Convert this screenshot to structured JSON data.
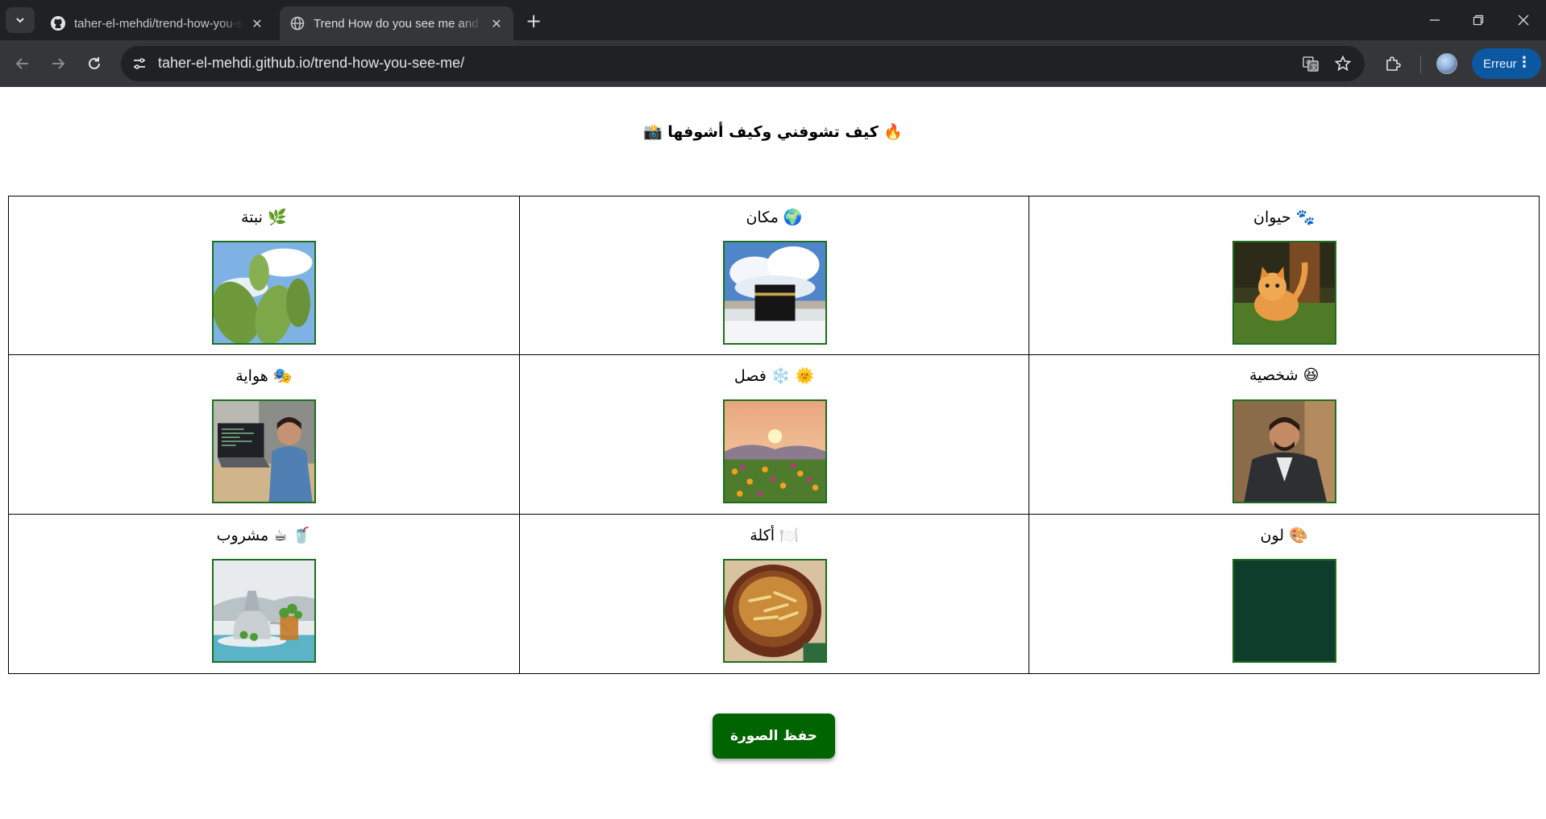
{
  "browser": {
    "tabs": [
      {
        "title": "taher-el-mehdi/trend-how-you-see-me",
        "icon": "github-icon",
        "active": false
      },
      {
        "title": "Trend How do you see me and how I see it",
        "icon": "globe-icon",
        "active": true
      }
    ],
    "url": "taher-el-mehdi.github.io/trend-how-you-see-me/",
    "profile_button_label": "Erreur",
    "accent_color": "#0b57a0"
  },
  "page": {
    "title": "🔥 كيف تشوفني وكيف أشوفها 📸",
    "cells": [
      {
        "label": "🐾 حيوان",
        "image": "orange-kitten-photo"
      },
      {
        "label": "🌍 مكان",
        "image": "kaaba-photo"
      },
      {
        "label": "🌿 نبتة",
        "image": "prickly-pear-cactus-photo"
      },
      {
        "label": "😆 شخصية",
        "image": "man-in-suit-photo"
      },
      {
        "label": "🌞 ❄️ فصل",
        "image": "flower-field-sunset-photo"
      },
      {
        "label": "🎭 هواية",
        "image": "programmer-laptop-photo"
      },
      {
        "label": "🎨 لون",
        "image": "color-swatch",
        "color": "#0f3d2c"
      },
      {
        "label": "🍽️ أكلة",
        "image": "tajine-photo"
      },
      {
        "label": "🥤 ☕ مشروب",
        "image": "mint-tea-photo"
      }
    ],
    "save_button_label": "حفظ الصورة",
    "button_color": "#006400"
  }
}
